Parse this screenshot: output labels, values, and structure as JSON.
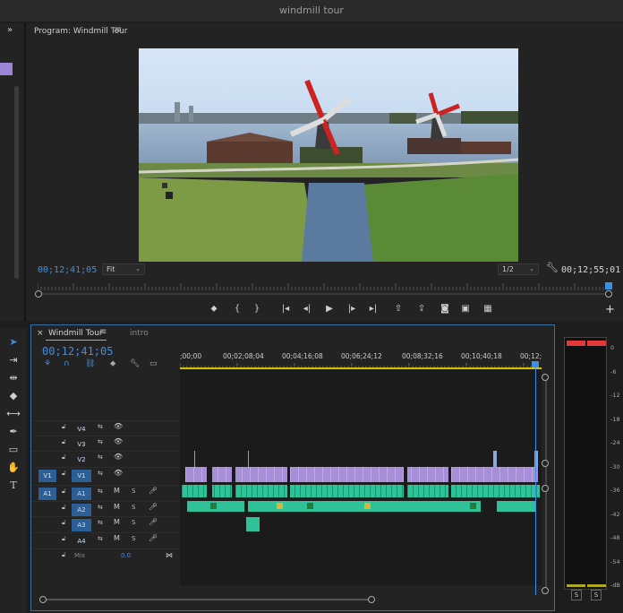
{
  "app": {
    "title": "windmill tour"
  },
  "colors": {
    "accent": "#3f8ee6",
    "video_clip": "#a78fd8",
    "audio_clip": "#2fc197",
    "peak": "#e23a3a",
    "work_area": "#d7c200"
  },
  "program_monitor": {
    "tab_label": "Program: Windmill Tour",
    "menu_icon": "hamburger-menu-icon",
    "timecode_current": "00;12;41;05",
    "timecode_duration": "00;12;55;01",
    "zoom": "Fit",
    "resolution": "1/2",
    "transport": [
      {
        "name": "add-marker-button",
        "glyph": "⬥"
      },
      {
        "name": "mark-in-button",
        "glyph": "{"
      },
      {
        "name": "mark-out-button",
        "glyph": "}"
      },
      {
        "name": "go-to-in-button",
        "glyph": "|◂"
      },
      {
        "name": "step-back-button",
        "glyph": "◂|"
      },
      {
        "name": "play-button",
        "glyph": "▶"
      },
      {
        "name": "step-forward-button",
        "glyph": "|▸"
      },
      {
        "name": "go-to-out-button",
        "glyph": "▸|"
      },
      {
        "name": "lift-button",
        "glyph": "⇧"
      },
      {
        "name": "extract-button",
        "glyph": "⇪"
      },
      {
        "name": "export-frame-button",
        "glyph": "◙"
      },
      {
        "name": "comparison-view-button",
        "glyph": "▣"
      },
      {
        "name": "vr-video-button",
        "glyph": "▦"
      }
    ],
    "add_button_label": "+"
  },
  "timeline": {
    "tab_label": "Windmill Tour",
    "tab_close": "×",
    "second_tab_label": "intro",
    "timecode": "00;12;41;05",
    "ruler_labels": [
      ";00;00",
      "00;02;08;04",
      "00;04;16;08",
      "00;06;24;12",
      "00;08;32;16",
      "00;10;40;18",
      "00;12;"
    ],
    "tracks": [
      {
        "id": "V4",
        "kind": "video",
        "source": "",
        "target_on": false
      },
      {
        "id": "V3",
        "kind": "video",
        "source": "",
        "target_on": false
      },
      {
        "id": "V2",
        "kind": "video",
        "source": "",
        "target_on": false
      },
      {
        "id": "V1",
        "kind": "video",
        "source": "V1",
        "target_on": true
      },
      {
        "id": "A1",
        "kind": "audio",
        "source": "A1",
        "target_on": true,
        "mute": "M",
        "solo": "S"
      },
      {
        "id": "A2",
        "kind": "audio",
        "source": "",
        "target_on": true,
        "mute": "M",
        "solo": "S"
      },
      {
        "id": "A3",
        "kind": "audio",
        "source": "",
        "target_on": true,
        "mute": "M",
        "solo": "S"
      },
      {
        "id": "A4",
        "kind": "audio",
        "source": "",
        "target_on": false,
        "mute": "M",
        "solo": "S"
      }
    ],
    "mix_label": "Mix",
    "mix_value": "0.0"
  },
  "audio_meter": {
    "db_labels": [
      "0",
      "-6",
      "-12",
      "-18",
      "-24",
      "-30",
      "-36",
      "-42",
      "-48",
      "-54",
      "-dB"
    ],
    "solo_left": "S",
    "solo_right": "S"
  }
}
